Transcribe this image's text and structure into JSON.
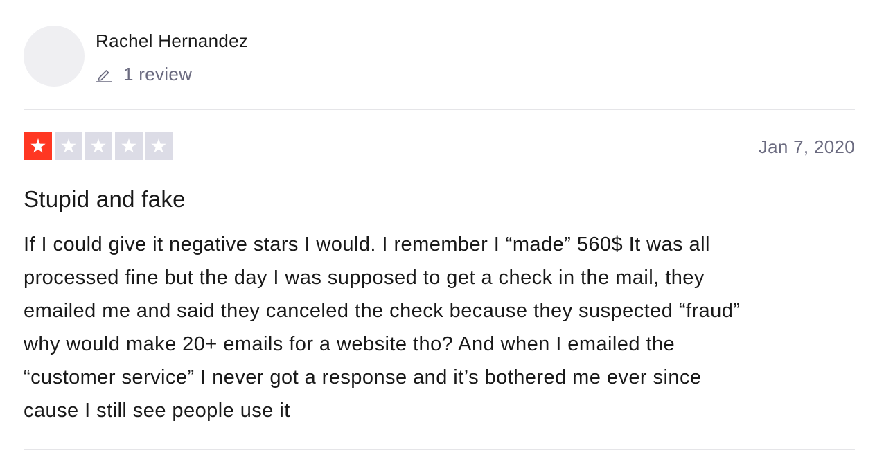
{
  "reviewer": {
    "name": "Rachel Hernandez",
    "review_count_label": "1 review"
  },
  "review": {
    "rating": 1,
    "max_rating": 5,
    "rating_color": "#ff3722",
    "empty_star_color": "#dcdce6",
    "date": "Jan 7, 2020",
    "title": "Stupid and fake",
    "body_lines": [
      "If I could give it negative stars I would. I remember I “made” 560$ It was all",
      "processed fine but the day I was supposed to get a check in the mail, they",
      "emailed me and said they canceled the check because they suspected “fraud”",
      "why would make 20+ emails for a website tho? And when I emailed the",
      "“customer service” I never got a response and it’s bothered me ever since",
      "cause I still see people use it"
    ]
  },
  "icons": {
    "review_count": "pencil-icon",
    "rating": "star-icon"
  }
}
